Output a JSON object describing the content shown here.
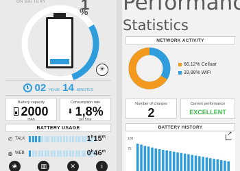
{
  "left": {
    "battery_label": "ON BATTERY",
    "percent": "1",
    "percent_sign": "%",
    "battery_level": 0.12,
    "time": {
      "hours": "02",
      "hours_unit": "HOUR",
      "minutes": "14",
      "minutes_unit": "MINUTES"
    },
    "capacity": {
      "title": "Battery capacity",
      "value": "2000",
      "unit": "mAh"
    },
    "consumption": {
      "title": "Consumption rate",
      "value": "1,8%",
      "unit": "per hour"
    },
    "usage": {
      "title": "BATTERY USAGE",
      "rows": [
        {
          "icon": "phone-icon",
          "label": "TALK",
          "active": 4,
          "total": 22,
          "hours": "1",
          "minutes": "15"
        },
        {
          "icon": "globe-icon",
          "label": "WEB",
          "active": 1,
          "total": 22,
          "hours": "0",
          "minutes": "46"
        }
      ]
    },
    "bottom_buttons": [
      {
        "name": "eco-button",
        "icon": "leaf-icon",
        "glyph": "❀"
      },
      {
        "name": "chart-button",
        "icon": "bar-chart-icon",
        "glyph": "▥"
      },
      {
        "name": "tools-button",
        "icon": "tools-icon",
        "glyph": "✕"
      },
      {
        "name": "info-button",
        "icon": "info-icon",
        "glyph": "i"
      }
    ],
    "colors": {
      "accent": "#2f9ddb",
      "accent_light": "#bcdff2"
    }
  },
  "right": {
    "page_title": "Performance",
    "section_title": "Statistics",
    "network": {
      "title": "NETWORK ACTIVITY",
      "cellular_label": "66,12% Celluar",
      "wifi_label": "33,88% WiFi",
      "cellular_value": 66.12,
      "wifi_value": 33.88,
      "cellular_color": "#f39a1e",
      "wifi_color": "#2f9ddb"
    },
    "charges": {
      "title": "Number of charges",
      "value": "2"
    },
    "performance": {
      "title": "Current performance",
      "value": "EXCELLENT",
      "color": "#3dbb4a"
    },
    "history": {
      "title": "BATTERY HISTORY",
      "yticks": [
        "100",
        "75"
      ]
    }
  },
  "chart_data": [
    {
      "type": "pie",
      "title": "NETWORK ACTIVITY",
      "categories": [
        "Celluar",
        "WiFi"
      ],
      "values": [
        66.12,
        33.88
      ],
      "colors": [
        "#f39a1e",
        "#2f9ddb"
      ]
    },
    {
      "type": "bar",
      "title": "BATTERY HISTORY",
      "ylim": [
        0,
        100
      ],
      "values": [
        85,
        82,
        78,
        76,
        73,
        70,
        68,
        66,
        64,
        62,
        60,
        58,
        56,
        54,
        52,
        50,
        48,
        46,
        44,
        42,
        40,
        38,
        36,
        34,
        32,
        30
      ]
    }
  ]
}
